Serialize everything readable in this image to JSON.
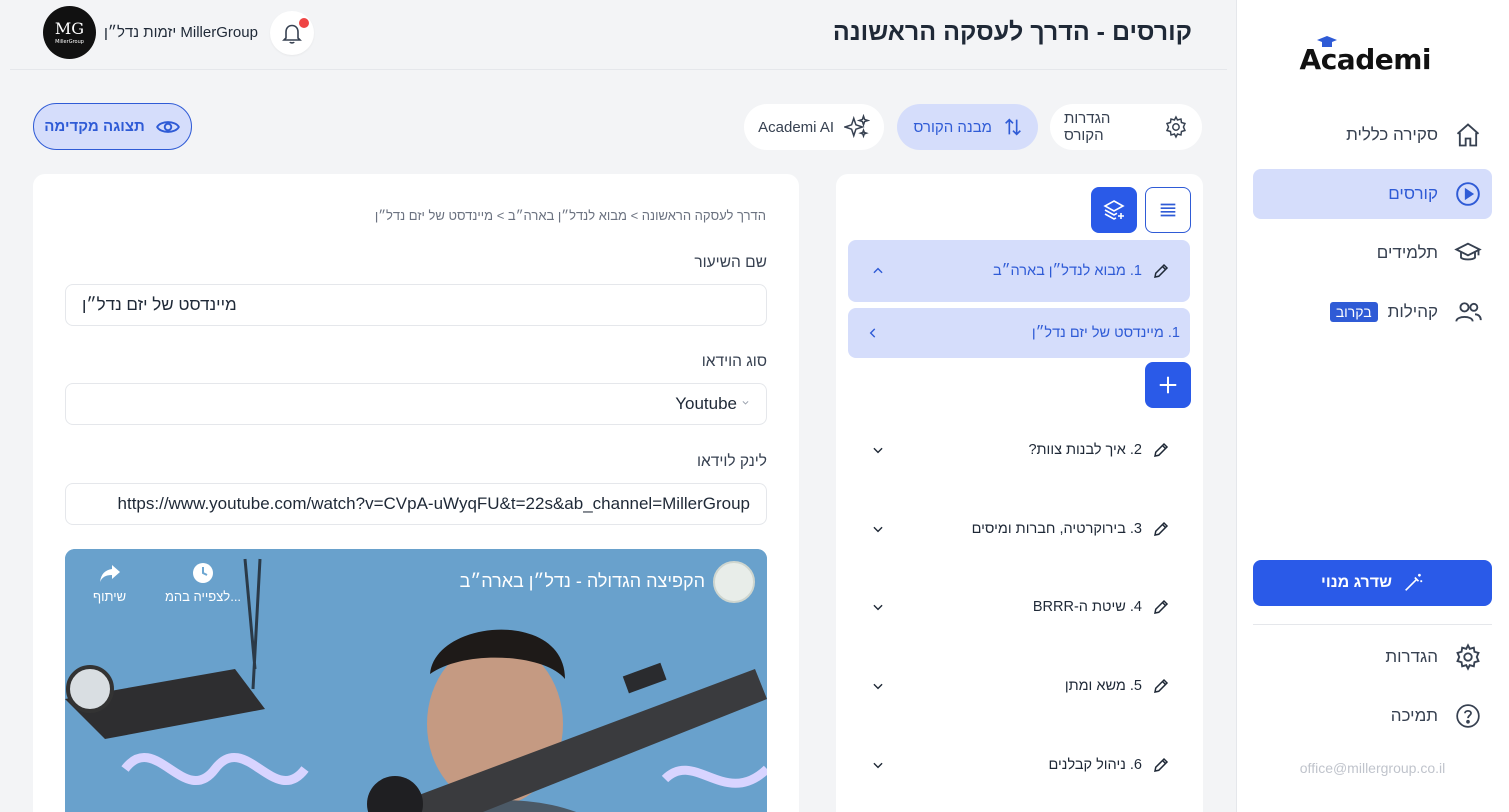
{
  "app": {
    "logo_text": "Academi"
  },
  "header": {
    "title": "קורסים - הדרך לעסקה הראשונה",
    "org_name": "MillerGroup יזמות נדל״ן",
    "avatar_mono": "MG",
    "avatar_small": "MillerGroup"
  },
  "sidebar": {
    "items": [
      {
        "label": "סקירה כללית",
        "icon": "home-icon"
      },
      {
        "label": "קורסים",
        "icon": "play-circle-icon",
        "active": true
      },
      {
        "label": "תלמידים",
        "icon": "graduation-cap-icon"
      },
      {
        "label": "קהילות",
        "icon": "users-icon",
        "badge": "בקרוב"
      }
    ],
    "upgrade_label": "שדרג מנוי",
    "settings_label": "הגדרות",
    "support_label": "תמיכה",
    "email": "office@millergroup.co.il"
  },
  "toolbar": {
    "course_settings": "הגדרות הקורס",
    "course_structure": "מבנה הקורס",
    "ai_label": "Academi AI",
    "preview_label": "תצוגה מקדימה"
  },
  "structure": {
    "chapters": [
      {
        "label": "1. מבוא לנדל״ן בארה״ב",
        "expanded": true
      },
      {
        "label": "2. איך לבנות צוות?"
      },
      {
        "label": "3. בירוקרטיה, חברות ומיסים"
      },
      {
        "label": "4. שיטת ה-BRRR"
      },
      {
        "label": "5. משא ומתן"
      },
      {
        "label": "6. ניהול קבלנים"
      }
    ],
    "lessons": [
      {
        "label": "1. מיינדסט של יזם נדל״ן"
      }
    ]
  },
  "editor": {
    "breadcrumb": "הדרך לעסקה הראשונה > מבוא לנדל״ן בארה״ב > מיינדסט של יזם נדל״ן",
    "lesson_name_label": "שם השיעור",
    "lesson_name_value": "מיינדסט של יזם נדל״ן",
    "video_type_label": "סוג הוידאו",
    "video_type_value": "Youtube",
    "video_link_label": "לינק לוידאו",
    "video_link_value": "https://www.youtube.com/watch?v=CVpA-uWyqFU&t=22s&ab_channel=MillerGroup"
  },
  "video": {
    "title": "הקפיצה הגדולה - נדל״ן בארה״ב",
    "watch_later": "לצפייה בהמ...",
    "share": "שיתוף"
  },
  "colors": {
    "accent": "#2a5ae8",
    "accent_soft": "#d5ddfb",
    "notification_dot": "#ef4444"
  }
}
